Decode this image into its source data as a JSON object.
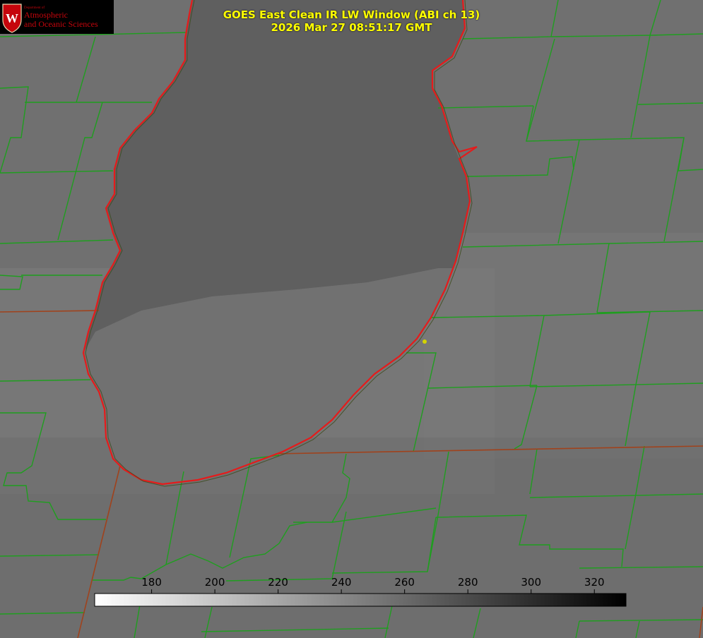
{
  "logo": {
    "dept": "Department of",
    "line1": "Atmospheric",
    "line2": "and Oceanic Sciences",
    "letter": "W"
  },
  "title": {
    "line1": "GOES East Clean IR LW Window (ABI ch 13)",
    "line2": "2026 Mar 27 08:51:17 GMT"
  },
  "colorbar": {
    "ticks": [
      "180",
      "200",
      "220",
      "240",
      "260",
      "280",
      "300",
      "320"
    ],
    "min": 162,
    "max": 330,
    "gradient_from": "#ffffff",
    "gradient_to": "#000000"
  },
  "colors": {
    "county_lines": "#1f9e1f",
    "state_lines": "#a0421c",
    "lake_outline": "#ff1a1a",
    "title_text": "#ffff00",
    "marker": "#d4d400"
  },
  "marker_label": "station-dot"
}
